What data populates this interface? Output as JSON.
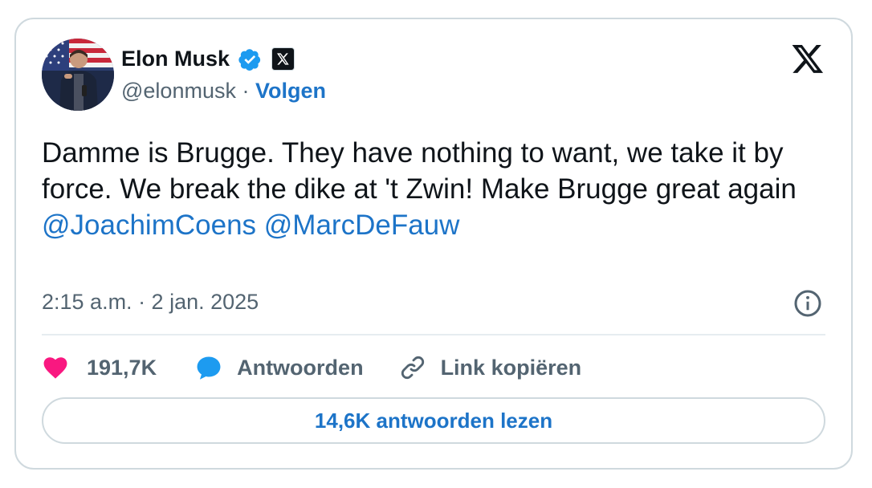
{
  "author": {
    "name": "Elon Musk",
    "handle": "@elonmusk",
    "separator": " · ",
    "follow_label": "Volgen",
    "verified_icon": "verified-badge-icon",
    "affiliate_icon": "x-affiliate-icon"
  },
  "tweet": {
    "text": "Damme is Brugge. They have nothing to want, we take it by force. We break the dike at 't Zwin! Make Brugge great again",
    "mention_1": "@JoachimCoens",
    "mention_2": "@MarcDeFauw",
    "timestamp": "2:15 a.m. · 2 jan. 2025"
  },
  "actions": {
    "likes_count": "191,7K",
    "reply_label": "Antwoorden",
    "copy_link_label": "Link kopiëren"
  },
  "read_replies_label": "14,6K antwoorden lezen",
  "colors": {
    "link": "#1d74c8",
    "like": "#f91880",
    "reply_icon": "#1d9bf0",
    "muted": "#536471",
    "border": "#cfd9de"
  }
}
